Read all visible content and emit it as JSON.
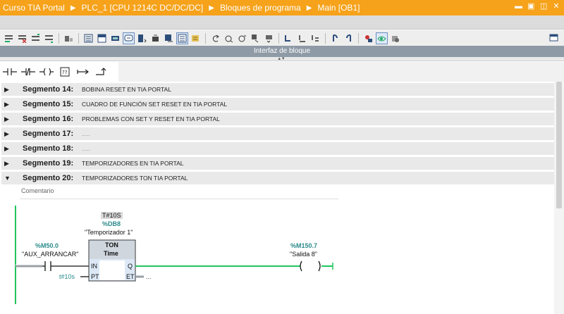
{
  "titlebar": {
    "breadcrumb": [
      "Curso TIA Portal",
      "PLC_1 [CPU 1214C DC/DC/DC]",
      "Bloques de programa",
      "Main [OB1]"
    ],
    "separator": "▶",
    "controls": [
      "minimize-icon",
      "restore-icon",
      "maximize-icon",
      "close-icon"
    ]
  },
  "colors": {
    "titlebar": "#f6a21a",
    "segment_header": "#e9e9e9",
    "rung_green": "#22c55e",
    "address_teal": "#2b8a8a",
    "interface_bar": "#8e9aa6"
  },
  "toolbar": {
    "icons": [
      "insert-network-icon",
      "delete-network-icon",
      "insert-row-icon",
      "append-row-icon",
      "absolute-symbolic-icon",
      "network-overview-icon",
      "comments-icon",
      "favorites-icon",
      "block-move-icon",
      "download-icon",
      "upload-icon",
      "monitor-icon",
      "compare-icon",
      "go-to-icon",
      "go-back-icon",
      "go-forward-icon",
      "reference-icon",
      "call-structure-icon",
      "jump-icon",
      "cross-ref-icon",
      "watch-icon",
      "tag-icon",
      "force-icon",
      "status-icon",
      "monitoring-on-icon",
      "db-icon"
    ],
    "right_icon": "panel-layout-icon"
  },
  "interface_bar": {
    "label": "Interfaz de bloque"
  },
  "lad_instructions": [
    {
      "name": "no-contact-icon",
      "glyph": "⊣⊢"
    },
    {
      "name": "nc-contact-icon",
      "glyph": "⊣/⊢"
    },
    {
      "name": "coil-icon",
      "glyph": "–( )–"
    },
    {
      "name": "empty-box-icon",
      "glyph": "??"
    },
    {
      "name": "open-branch-icon",
      "glyph": "↦"
    },
    {
      "name": "close-branch-icon",
      "glyph": "↱"
    }
  ],
  "segments": [
    {
      "number": "Segmento 14:",
      "title": "BOBINA RESET EN TIA PORTAL",
      "expanded": false
    },
    {
      "number": "Segmento 15:",
      "title": "CUADRO DE FUNCIÓN SET RESET EN TIA PORTAL",
      "expanded": false
    },
    {
      "number": "Segmento 16:",
      "title": "PROBLEMAS CON SET Y RESET EN TIA PORTAL",
      "expanded": false
    },
    {
      "number": "Segmento 17:",
      "title": ".....",
      "expanded": false
    },
    {
      "number": "Segmento 18:",
      "title": ".....",
      "expanded": false
    },
    {
      "number": "Segmento 19:",
      "title": "TEMPORIZADORES EN TIA PORTAL",
      "expanded": false
    },
    {
      "number": "Segmento 20:",
      "title": "TEMPORIZADORES TON TIA PORTAL",
      "expanded": true
    }
  ],
  "network20": {
    "comment_label": "Comentario",
    "timer": {
      "preset_badge": "T#10S",
      "db_address": "%DB8",
      "db_name": "\"Temporizador 1\"",
      "type": "TON",
      "subtype": "Time",
      "in_pin": "IN",
      "pt_pin": "PT",
      "q_pin": "Q",
      "et_pin": "ET",
      "pt_value": "t#10s",
      "et_value": "..."
    },
    "contact": {
      "address": "%M50.0",
      "name": "\"AUX_ARRANCAR\""
    },
    "coil": {
      "address": "%M150.7",
      "name": "\"Salida 8\""
    }
  }
}
